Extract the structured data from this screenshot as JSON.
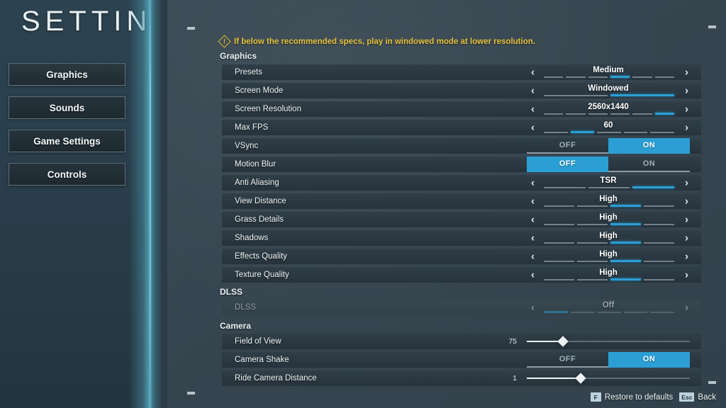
{
  "sidebar": {
    "title": "SETTINGS",
    "items": [
      {
        "label": "Graphics",
        "selected": true
      },
      {
        "label": "Sounds",
        "selected": false
      },
      {
        "label": "Game Settings",
        "selected": false
      },
      {
        "label": "Controls",
        "selected": false
      }
    ]
  },
  "warning": {
    "icon": "warning-diamond-icon",
    "glyph": "!",
    "text": "If below the recommended specs, play in windowed mode at lower resolution.",
    "color": "#e5c13c"
  },
  "sections": [
    {
      "id": "graphics",
      "title": "Graphics"
    },
    {
      "id": "dlss",
      "title": "DLSS"
    },
    {
      "id": "camera",
      "title": "Camera"
    }
  ],
  "graphics_rows": [
    {
      "label": "Presets",
      "type": "stepper",
      "value": "Medium",
      "segments": 6,
      "active": 4,
      "disabled": false
    },
    {
      "label": "Screen Mode",
      "type": "stepper",
      "value": "Windowed",
      "segments": 2,
      "active": 2,
      "disabled": false
    },
    {
      "label": "Screen Resolution",
      "type": "stepper",
      "value": "2560x1440",
      "segments": 6,
      "active": 6,
      "disabled": false
    },
    {
      "label": "Max FPS",
      "type": "stepper",
      "value": "60",
      "segments": 5,
      "active": 2,
      "disabled": false
    },
    {
      "label": "VSync",
      "type": "toggle",
      "value": "ON",
      "off_label": "OFF",
      "on_label": "ON",
      "disabled": false
    },
    {
      "label": "Motion Blur",
      "type": "toggle",
      "value": "OFF",
      "off_label": "OFF",
      "on_label": "ON",
      "disabled": false
    },
    {
      "label": "Anti Aliasing",
      "type": "stepper",
      "value": "TSR",
      "segments": 3,
      "active": 3,
      "disabled": false
    },
    {
      "label": "View Distance",
      "type": "stepper",
      "value": "High",
      "segments": 4,
      "active": 3,
      "disabled": false
    },
    {
      "label": "Grass Details",
      "type": "stepper",
      "value": "High",
      "segments": 4,
      "active": 3,
      "disabled": false
    },
    {
      "label": "Shadows",
      "type": "stepper",
      "value": "High",
      "segments": 4,
      "active": 3,
      "disabled": false
    },
    {
      "label": "Effects Quality",
      "type": "stepper",
      "value": "High",
      "segments": 4,
      "active": 3,
      "disabled": false
    },
    {
      "label": "Texture Quality",
      "type": "stepper",
      "value": "High",
      "segments": 4,
      "active": 3,
      "disabled": false
    }
  ],
  "dlss_rows": [
    {
      "label": "DLSS",
      "type": "stepper",
      "value": "Off",
      "segments": 5,
      "active": 1,
      "disabled": true
    }
  ],
  "camera_rows": [
    {
      "label": "Field of View",
      "type": "slider",
      "value": "75",
      "percent": 22,
      "disabled": false
    },
    {
      "label": "Camera Shake",
      "type": "toggle",
      "value": "ON",
      "off_label": "OFF",
      "on_label": "ON",
      "disabled": false
    },
    {
      "label": "Ride Camera Distance",
      "type": "slider",
      "value": "1",
      "percent": 33,
      "disabled": false
    }
  ],
  "footer": {
    "hints": [
      {
        "key": "F",
        "label": "Restore to defaults"
      },
      {
        "key": "Esc",
        "label": "Back"
      }
    ]
  },
  "theme": {
    "accent": "#2b9fd4",
    "warning": "#e5c13c",
    "panel_bg": "#36454f",
    "sidebar_bg": "#2a3f4c",
    "row_bg": "#2b3740",
    "text": "#eef4f6"
  }
}
